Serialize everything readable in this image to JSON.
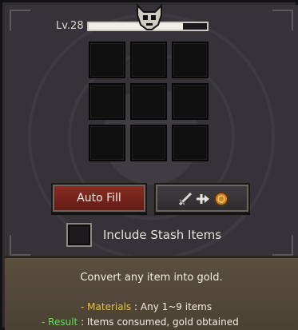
{
  "player": {
    "level_label": "Lv.28",
    "xp_progress": 0.8
  },
  "stash": {
    "slots": 9,
    "include_label": "Include Stash Items",
    "include_checked": false
  },
  "buttons": {
    "auto_fill_label": "Auto Fill",
    "convert_icon": "dagger-arrow-coin-icon"
  },
  "description": {
    "headline": "Convert any item into gold.",
    "materials_dash": "-",
    "materials_label": "Materials",
    "materials_value": ": Any 1~9 items",
    "result_dash": "-",
    "result_label": "Result",
    "result_value": ": Items consumed, gold obtained"
  },
  "colors": {
    "materials": "#e8c33a",
    "result": "#5fe05a",
    "auto_fill_button": "#7a241a"
  }
}
